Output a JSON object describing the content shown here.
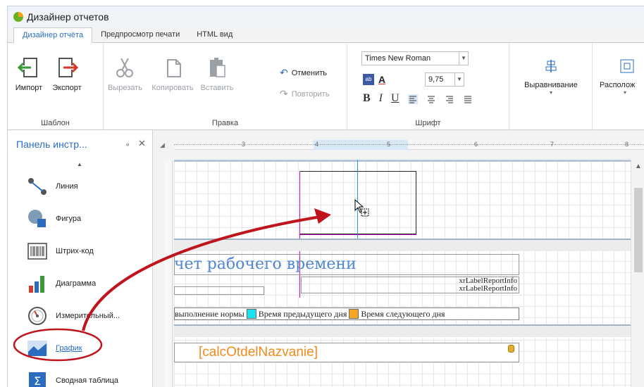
{
  "window": {
    "title": "Дизайнер отчетов"
  },
  "tabs": [
    {
      "label": "Дизайнер отчёта"
    },
    {
      "label": "Предпросмотр печати"
    },
    {
      "label": "HTML вид"
    }
  ],
  "ribbon": {
    "template_group": {
      "label": "Шаблон",
      "import_label": "Импорт",
      "export_label": "Экспорт"
    },
    "edit_group": {
      "label": "Правка",
      "cut_label": "Вырезать",
      "copy_label": "Копировать",
      "paste_label": "Вставить",
      "undo_label": "Отменить",
      "redo_label": "Повторить"
    },
    "font_group": {
      "label": "Шрифт",
      "font_name": "Times New Roman",
      "font_size": "9,75",
      "bold": "B",
      "italic": "I",
      "underline": "U"
    },
    "align_label": "Выравнивание",
    "arrange_label": "Располож"
  },
  "toolbox": {
    "title": "Панель инстр...",
    "items": [
      {
        "label": "Линия",
        "icon": "line-icon"
      },
      {
        "label": "Фигура",
        "icon": "shape-icon"
      },
      {
        "label": "Штрих-код",
        "icon": "barcode-icon"
      },
      {
        "label": "Диаграмма",
        "icon": "bar-chart-icon"
      },
      {
        "label": "Измерительный...",
        "icon": "gauge-icon"
      },
      {
        "label": "График",
        "icon": "sparkline-icon"
      },
      {
        "label": "Сводная таблица",
        "icon": "sigma-icon"
      }
    ]
  },
  "ruler": {
    "numbers": [
      "3",
      "4",
      "5",
      "6",
      "7",
      "8"
    ]
  },
  "report": {
    "title_text": "чет рабочего времени",
    "info1": "xrLabelReportInfo",
    "info2": "xrLabelReportInfo",
    "legend1": "выполнение нормы",
    "legend2": "Время предыдущего дня",
    "legend3": "Время следующего дня",
    "calc_field": "[calcOtdelNazvanie]"
  },
  "colors": {
    "accent": "#2b6cbf",
    "cyan_swatch": "#19e3f0",
    "orange_swatch": "#f5a623",
    "arrow": "#c0141c",
    "calc_text": "#f08a1c"
  }
}
